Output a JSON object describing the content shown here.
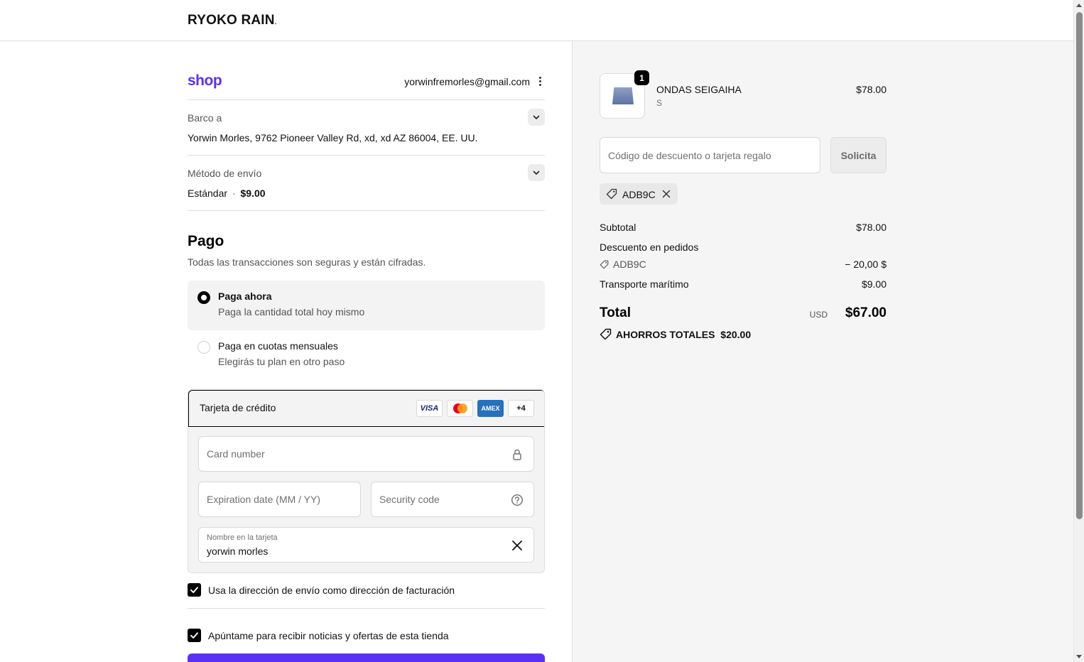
{
  "header": {
    "logo_text": "RYOKO RAIN",
    "logo_mark": "."
  },
  "account": {
    "shop_logo": "shop",
    "email": "yorwinfremorles@gmail.com"
  },
  "shipping_address": {
    "label": "Barco a",
    "value": "Yorwin Morles, 9762 Pioneer Valley Rd, xd, xd AZ 86004, EE. UU."
  },
  "shipping_method": {
    "label": "Método de envío",
    "name": "Estándar",
    "separator": "·",
    "price": "$9.00"
  },
  "payment": {
    "heading": "Pago",
    "subtitle": "Todas las transacciones son seguras y están cifradas.",
    "options": [
      {
        "title": "Paga ahora",
        "subtitle": "Paga la cantidad total hoy mismo",
        "selected": true
      },
      {
        "title": "Paga en cuotas mensuales",
        "subtitle": "Elegirás tu plan en otro paso",
        "selected": false
      }
    ],
    "credit_card": {
      "title": "Tarjeta de crédito",
      "card_logos": {
        "visa": "VISA",
        "amex": "AMEX",
        "more": "+4"
      },
      "card_number_placeholder": "Card number",
      "expiration_placeholder": "Expiration date (MM / YY)",
      "security_code_placeholder": "Security code",
      "name_label": "Nombre en la tarjeta",
      "name_value": "yorwin morles"
    },
    "billing_checkbox": {
      "label": "Usa la dirección de envío como dirección de facturación",
      "checked": true
    },
    "newsletter_checkbox": {
      "label": "Apúntame para recibir noticias y ofertas de esta tienda",
      "checked": true
    },
    "accent_color": "#5a31f4"
  },
  "summary": {
    "product": {
      "name": "ONDAS SEIGAIHA",
      "variant": "S",
      "price": "$78.00",
      "quantity": "1"
    },
    "discount_placeholder": "Código de descuento o tarjeta regalo",
    "apply_label": "Solicita",
    "applied_code": "ADB9C",
    "subtotal_label": "Subtotal",
    "subtotal_value": "$78.00",
    "order_discount_label": "Descuento en pedidos",
    "order_discount_code": "ADB9C",
    "order_discount_value": "− 20,00 $",
    "shipping_label": "Transporte marítimo",
    "shipping_value": "$9.00",
    "total_label": "Total",
    "total_currency": "USD",
    "total_value": "$67.00",
    "savings_label": "AHORROS TOTALES",
    "savings_value": "$20.00"
  }
}
